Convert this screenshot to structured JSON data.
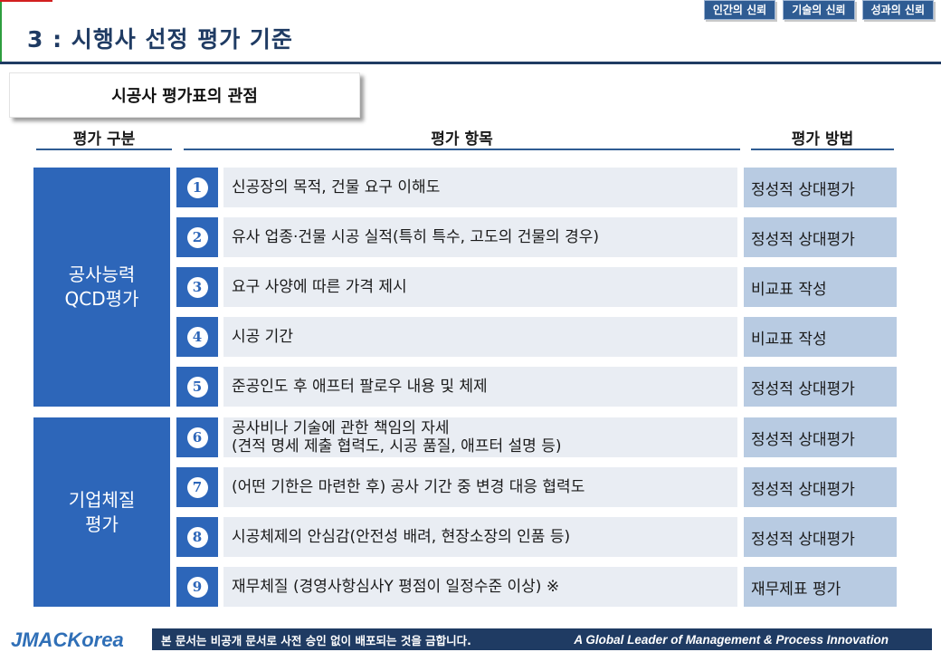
{
  "top_tabs": [
    "인간의 신뢰",
    "기술의 신뢰",
    "성과의 신뢰"
  ],
  "page_title": "3 : 시행사 선정 평가 기준",
  "section_title": "시공사 평가표의 관점",
  "column_headers": {
    "category": "평가 구분",
    "item": "평가 항목",
    "method": "평가 방법"
  },
  "groups": [
    {
      "label": "공사능력\nQCD평가"
    },
    {
      "label": "기업체질\n평가"
    }
  ],
  "rows": [
    {
      "num": "1",
      "item": "신공장의 목적, 건물 요구 이해도",
      "method": "정성적 상대평가"
    },
    {
      "num": "2",
      "item": "유사 업종·건물 시공 실적(특히 특수, 고도의 건물의 경우)",
      "method": "정성적 상대평가"
    },
    {
      "num": "3",
      "item": "요구 사양에 따른 가격 제시",
      "method": "비교표 작성"
    },
    {
      "num": "4",
      "item": "시공 기간",
      "method": "비교표 작성"
    },
    {
      "num": "5",
      "item": "준공인도 후 애프터 팔로우 내용 및 체제",
      "method": "정성적 상대평가"
    },
    {
      "num": "6",
      "item": "공사비나 기술에 관한 책임의 자세\n(견적 명세 제출 협력도, 시공 품질, 애프터 설명 등)",
      "method": "정성적 상대평가"
    },
    {
      "num": "7",
      "item": "(어떤 기한은 마련한 후) 공사 기간 중 변경 대응 협력도",
      "method": "정성적 상대평가"
    },
    {
      "num": "8",
      "item": "시공체제의 안심감(안전성 배려, 현장소장의 인품 등)",
      "method": "정성적 상대평가"
    },
    {
      "num": "9",
      "item": "재무체질 (경영사항심사Y 평점이 일정수준 이상) ※",
      "method": "재무제표 평가"
    }
  ],
  "watermark": "JMAC Korea",
  "footer": {
    "logo": "JMACKorea",
    "notice": "본 문서는 비공개 문서로 사전 승인 없이 배포되는 것을 금합니다.",
    "slogan": "A Global Leader of Management & Process  Innovation"
  },
  "colors": {
    "navy": "#1f3b63",
    "group_blue": "#2d66b9",
    "item_bg": "#e9edf3",
    "method_bg": "#b8cbe2"
  }
}
